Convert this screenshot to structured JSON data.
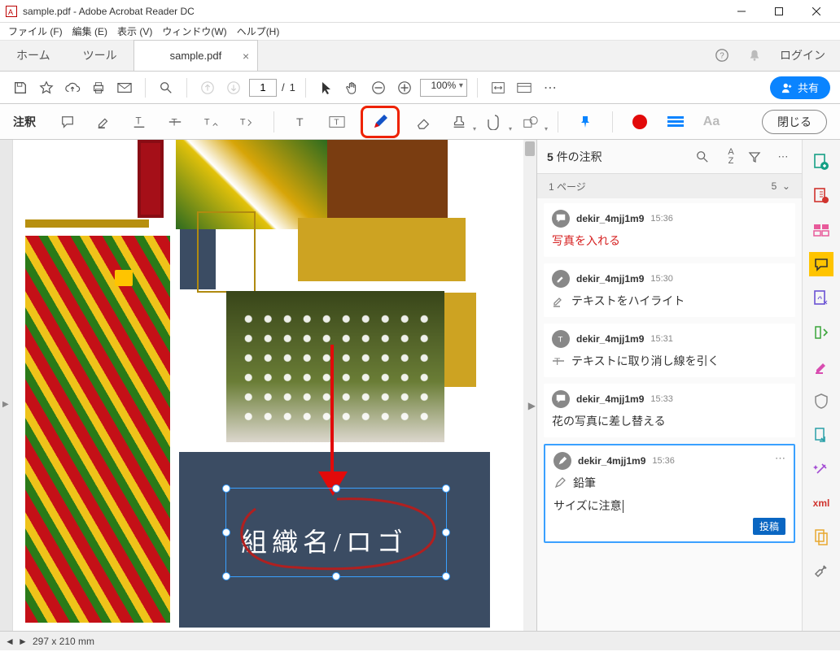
{
  "window": {
    "title": "sample.pdf - Adobe Acrobat Reader DC"
  },
  "menu": {
    "file": "ファイル (F)",
    "edit": "編集 (E)",
    "view": "表示 (V)",
    "window": "ウィンドウ(W)",
    "help": "ヘルプ(H)"
  },
  "tabs": {
    "home": "ホーム",
    "tools": "ツール",
    "active": "sample.pdf",
    "login": "ログイン"
  },
  "toolbar": {
    "page_current": "1",
    "page_sep": "/",
    "page_total": "1",
    "zoom": "100%",
    "share": "共有"
  },
  "annot": {
    "label": "注釈",
    "close": "閉じる"
  },
  "doc": {
    "org_text": "組織名/ロゴ"
  },
  "comments": {
    "count_num": "5",
    "count_label": "件の注釈",
    "page_header": "1 ページ",
    "page_count": "5",
    "items": [
      {
        "user": "dekir_4mjj1m9",
        "time": "15:36",
        "type": "note",
        "text": "写真を入れる"
      },
      {
        "user": "dekir_4mjj1m9",
        "time": "15:30",
        "type": "highlight",
        "text": "テキストをハイライト"
      },
      {
        "user": "dekir_4mjj1m9",
        "time": "15:31",
        "type": "strike",
        "text": "テキストに取り消し線を引く"
      },
      {
        "user": "dekir_4mjj1m9",
        "time": "15:33",
        "type": "note",
        "text": "花の写真に差し替える"
      },
      {
        "user": "dekir_4mjj1m9",
        "time": "15:36",
        "type": "pencil",
        "label": "鉛筆",
        "edit": "サイズに注意",
        "post": "投稿"
      }
    ]
  },
  "status": {
    "dims": "297 x 210 mm"
  }
}
